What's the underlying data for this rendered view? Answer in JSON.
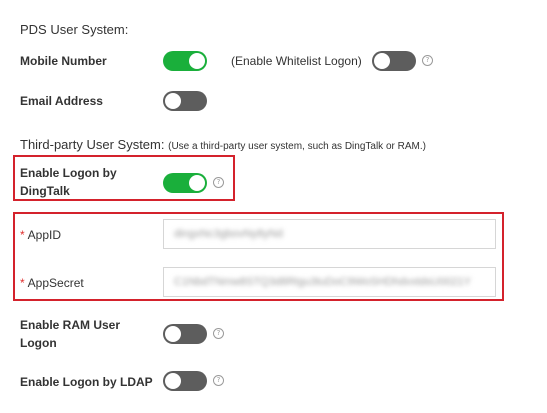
{
  "pds": {
    "title": "PDS User System:",
    "mobile_label": "Mobile Number",
    "mobile_on": true,
    "whitelist_label": "(Enable Whitelist Logon)",
    "whitelist_on": false,
    "email_label": "Email Address",
    "email_on": false
  },
  "third_party": {
    "title": "Third-party User System:",
    "note": "(Use a third-party user system, such as DingTalk or RAM.)",
    "dingtalk_label": "Enable Logon by DingTalk",
    "dingtalk_on": true,
    "appid_label": "AppID",
    "appid_value": "dingxNc3gbovNy8yNd",
    "appsecret_label": "AppSecret",
    "appsecret_value": "C1NbdTNmw8STQ3d8Rtgu3tuDoC9WoSHDhdvxtdsU0021Y",
    "required_mark": "*",
    "ram_label": "Enable RAM User Logon",
    "ram_on": false,
    "ldap_label": "Enable Logon by LDAP",
    "ldap_on": false
  },
  "help_glyph": "?",
  "colors": {
    "toggle_on": "#1aaf3b",
    "toggle_off": "#5d5d5d",
    "highlight": "#d4222c"
  }
}
